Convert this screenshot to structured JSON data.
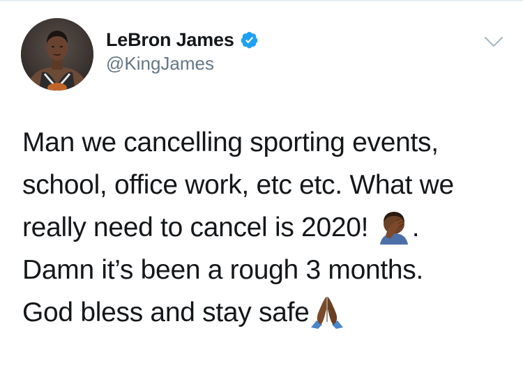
{
  "user": {
    "display_name": "LeBron James",
    "handle": "@KingJames",
    "verified": true
  },
  "tweet": {
    "lines": [
      "Man we cancelling sporting events,",
      "school, office work, etc etc. What we",
      "really need to cancel is 2020! ",
      ".",
      "Damn it’s been a rough 3 months.",
      "God bless and stay safe"
    ],
    "emojis": [
      "face-palm-emoji",
      "folded-hands-emoji"
    ]
  },
  "colors": {
    "text": "#14171a",
    "secondary_text": "#657786",
    "verified_badge": "#1da1f2",
    "border": "#e6ecf0",
    "chevron": "#aab8c2",
    "emoji_skin": "#7a4a2a"
  }
}
